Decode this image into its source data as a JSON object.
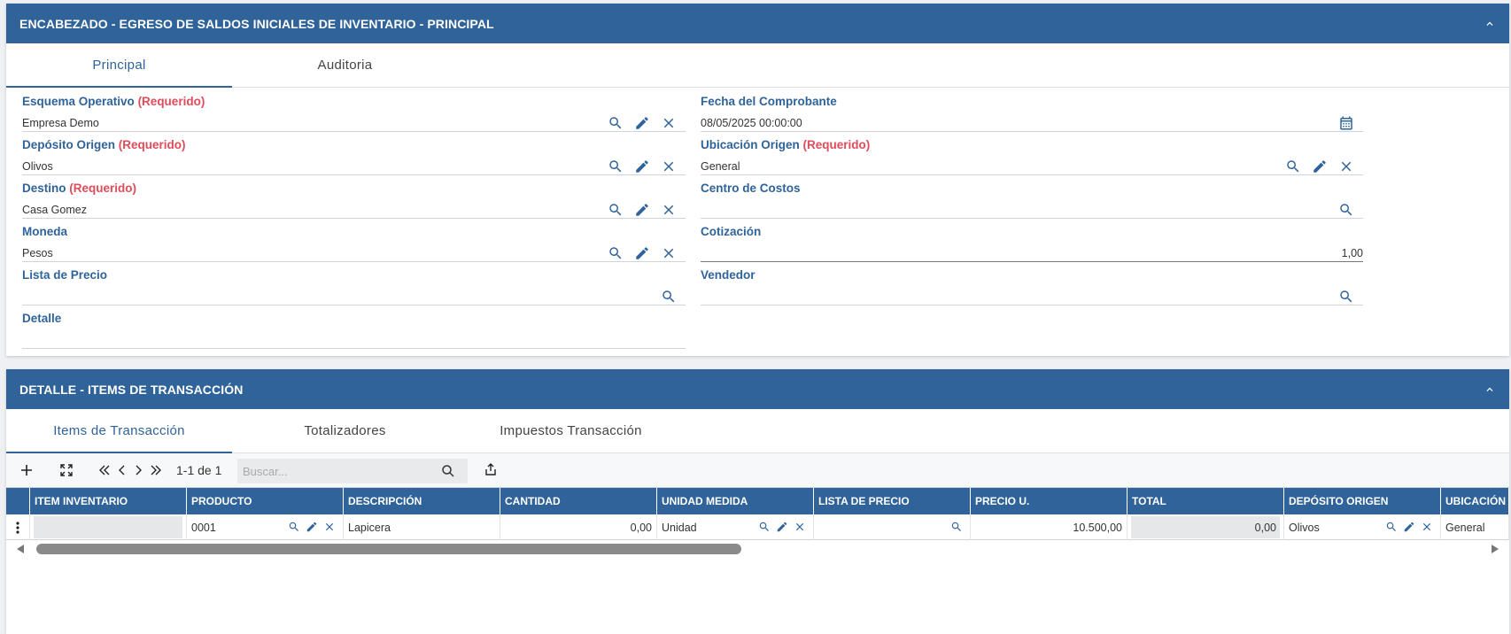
{
  "header_panel": {
    "title": "ENCABEZADO - EGRESO DE SALDOS INICIALES DE INVENTARIO - PRINCIPAL",
    "tabs": [
      "Principal",
      "Auditoria"
    ],
    "required_tag": "(Requerido)",
    "fields": {
      "esquema": {
        "label": "Esquema Operativo",
        "value": "Empresa Demo"
      },
      "deposito": {
        "label": "Depósito Origen",
        "value": "Olivos"
      },
      "destino": {
        "label": "Destino",
        "value": "Casa Gomez"
      },
      "moneda": {
        "label": "Moneda",
        "value": "Pesos"
      },
      "lista": {
        "label": "Lista de Precio",
        "value": ""
      },
      "detalle": {
        "label": "Detalle",
        "value": ""
      },
      "fecha": {
        "label": "Fecha del Comprobante",
        "value": "08/05/2025 00:00:00"
      },
      "ubicacion": {
        "label": "Ubicación Origen",
        "value": "General"
      },
      "centro": {
        "label": "Centro de Costos",
        "value": ""
      },
      "cotizacion": {
        "label": "Cotización",
        "value": "1,00"
      },
      "vendedor": {
        "label": "Vendedor",
        "value": ""
      }
    }
  },
  "detail_panel": {
    "title": "DETALLE - ITEMS DE TRANSACCIÓN",
    "tabs": [
      "Items de Transacción",
      "Totalizadores",
      "Impuestos Transacción"
    ],
    "pager": "1-1 de 1",
    "search_placeholder": "Buscar...",
    "columns": [
      "ITEM INVENTARIO",
      "PRODUCTO",
      "DESCRIPCIÓN",
      "CANTIDAD",
      "UNIDAD MEDIDA",
      "LISTA DE PRECIO",
      "PRECIO U.",
      "TOTAL",
      "DEPÓSITO ORIGEN",
      "UBICACIÓN"
    ],
    "row": {
      "item": "",
      "producto": "0001",
      "descripcion": "Lapicera",
      "cantidad": "0,00",
      "unidad": "Unidad",
      "lista": "",
      "precio": "10.500,00",
      "total": "0,00",
      "deposito": "Olivos",
      "ubicacion": "General"
    }
  },
  "colors": {
    "header_blue": "#2f6399",
    "required_red": "#e14b5a"
  }
}
